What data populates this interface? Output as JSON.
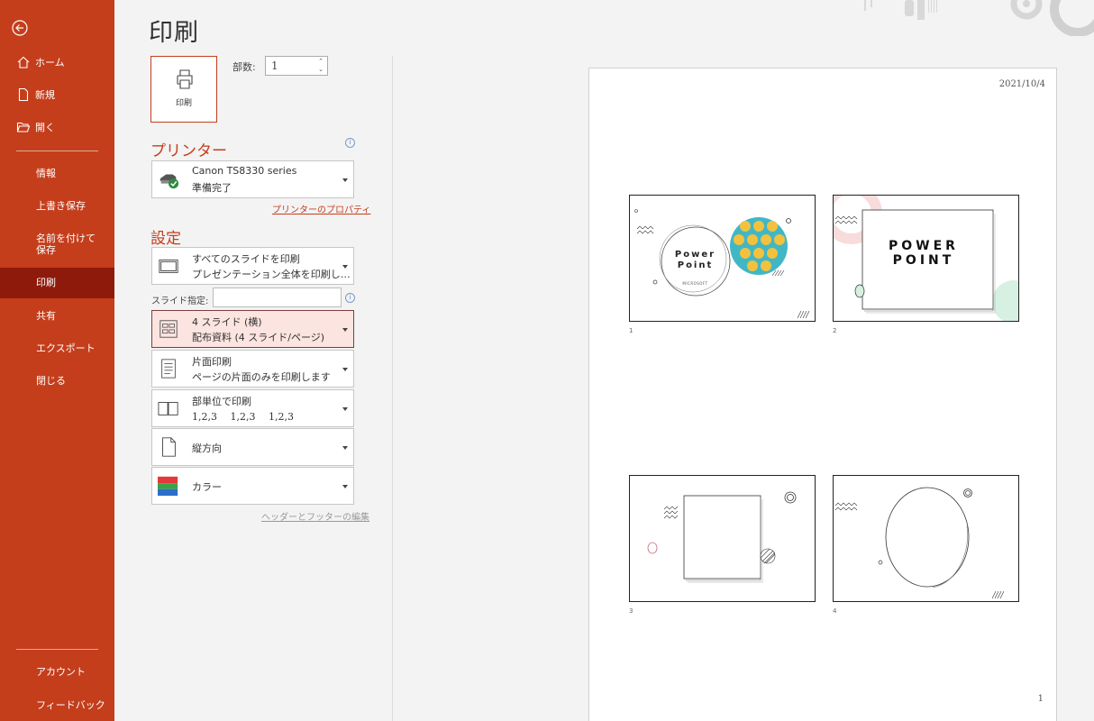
{
  "sidebar": {
    "home": "ホーム",
    "new": "新規",
    "open": "開く",
    "items": [
      "情報",
      "上書き保存",
      "名前を付けて保存",
      "印刷",
      "共有",
      "エクスポート",
      "閉じる"
    ],
    "account": "アカウント",
    "feedback": "フィードバック"
  },
  "title": "印刷",
  "print_button": "印刷",
  "copies": {
    "label": "部数:",
    "value": "1"
  },
  "printer": {
    "heading": "プリンター",
    "name": "Canon TS8330 series",
    "status": "準備完了",
    "properties_link": "プリンターのプロパティ"
  },
  "settings": {
    "heading": "設定",
    "print_range": {
      "line1": "すべてのスライドを印刷",
      "line2": "プレゼンテーション全体を印刷し…"
    },
    "slides_label": "スライド指定:",
    "layout": {
      "line1": "4 スライド (横)",
      "line2": "配布資料 (4 スライド/ページ)"
    },
    "sides": {
      "line1": "片面印刷",
      "line2": "ページの片面のみを印刷します"
    },
    "collate": {
      "line1": "部単位で印刷",
      "line2": "1,2,3　 1,2,3　 1,2,3"
    },
    "orientation": "縦方向",
    "color": "カラー",
    "header_footer_link": "ヘッダーとフッターの編集"
  },
  "preview": {
    "date": "2021/10/4",
    "page_number": "1",
    "slides": [
      {
        "num": "1",
        "title_line1": "Power",
        "title_line2": "Point",
        "subtitle": "MICROSOFT"
      },
      {
        "num": "2",
        "title_line1": "POWER",
        "title_line2": "POINT"
      },
      {
        "num": "3"
      },
      {
        "num": "4"
      }
    ]
  },
  "colors": {
    "accent": "#c43e1c",
    "active": "#8e1a0b",
    "highlight": "#fce4e0"
  }
}
